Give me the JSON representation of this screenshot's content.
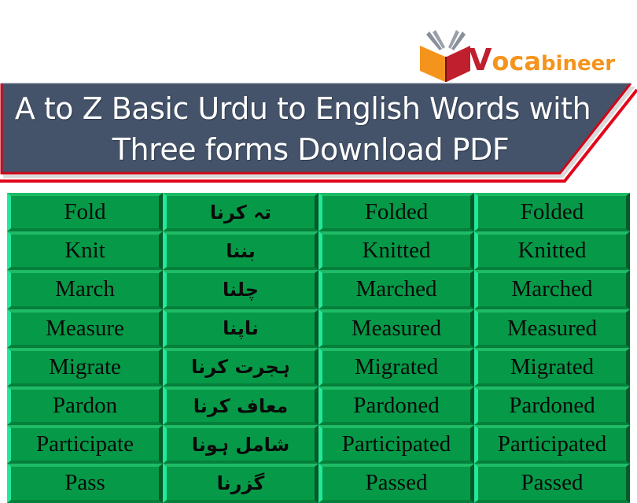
{
  "logo": {
    "brand_initial": "V",
    "brand_main": "oca",
    "brand_rest": "bineer",
    "colors": {
      "orange": "#f4941d",
      "red": "#c0202e",
      "gray": "#8a8f99"
    }
  },
  "banner": {
    "title_line1": "A to Z Basic Urdu to English Words with",
    "title_line2": "Three forms Download PDF",
    "colors": {
      "background": "#44536a",
      "accent": "#e3061b",
      "text": "#ffffff"
    }
  },
  "table": {
    "colors": {
      "cell": "#069a48",
      "bevel_light": "#22e89a",
      "bevel_dark": "#045a28",
      "text": "#0a0a0a"
    },
    "rows": [
      {
        "base": "Fold",
        "urdu": "تہ کرنا",
        "past": "Folded",
        "past_participle": "Folded"
      },
      {
        "base": "Knit",
        "urdu": "بننا",
        "past": "Knitted",
        "past_participle": "Knitted"
      },
      {
        "base": "March",
        "urdu": "چلنا",
        "past": "Marched",
        "past_participle": "Marched"
      },
      {
        "base": "Measure",
        "urdu": "ناپنا",
        "past": "Measured",
        "past_participle": "Measured"
      },
      {
        "base": "Migrate",
        "urdu": "ہجرت کرنا",
        "past": "Migrated",
        "past_participle": "Migrated"
      },
      {
        "base": "Pardon",
        "urdu": "معاف کرنا",
        "past": "Pardoned",
        "past_participle": "Pardoned"
      },
      {
        "base": "Participate",
        "urdu": "شامل ہونا",
        "past": "Participated",
        "past_participle": "Participated"
      },
      {
        "base": "Pass",
        "urdu": "گزرنا",
        "past": "Passed",
        "past_participle": "Passed"
      }
    ]
  }
}
